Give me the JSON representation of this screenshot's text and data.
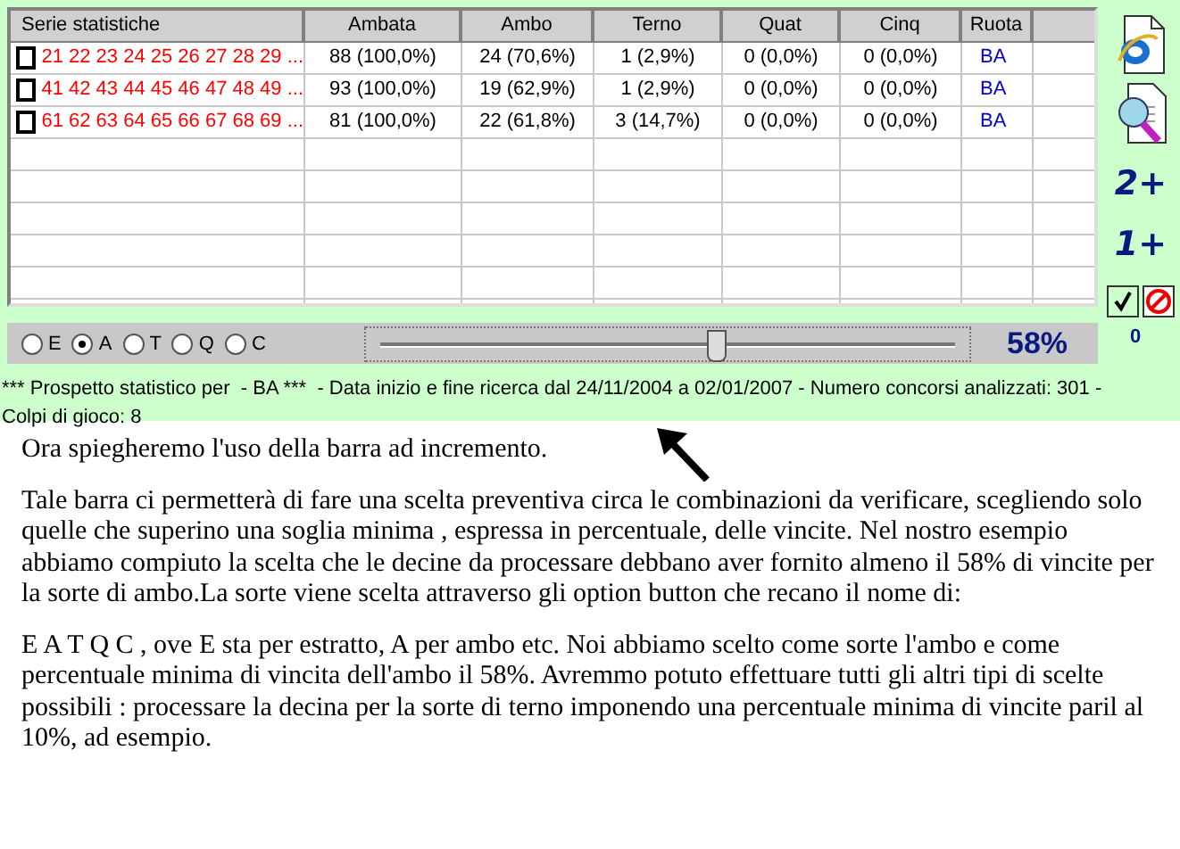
{
  "table": {
    "columns": [
      "Serie statistiche",
      "Ambata",
      "Ambo",
      "Terno",
      "Quat",
      "Cinq",
      "Ruota"
    ],
    "rows": [
      {
        "checked": false,
        "serie": "21 22 23 24 25 26 27 28 29 ...",
        "ambata": "88 (100,0%)",
        "ambo": "24 (70,6%)",
        "terno": "1 (2,9%)",
        "quat": "0 (0,0%)",
        "cinq": "0 (0,0%)",
        "ruota": "BA"
      },
      {
        "checked": false,
        "serie": "41 42 43 44 45 46 47 48 49 ...",
        "ambata": "93 (100,0%)",
        "ambo": "19 (62,9%)",
        "terno": "1 (2,9%)",
        "quat": "0 (0,0%)",
        "cinq": "0 (0,0%)",
        "ruota": "BA"
      },
      {
        "checked": false,
        "serie": "61 62 63 64 65 66 67 68 69 ...",
        "ambata": "81 (100,0%)",
        "ambo": "22 (61,8%)",
        "terno": "3 (14,7%)",
        "quat": "0 (0,0%)",
        "cinq": "0 (0,0%)",
        "ruota": "BA"
      }
    ]
  },
  "side_buttons": [
    {
      "kind": "ie"
    },
    {
      "kind": "preview"
    },
    {
      "kind": "text",
      "label": "2+"
    },
    {
      "kind": "text",
      "label": "1+"
    }
  ],
  "side_counter": "0",
  "options": [
    {
      "label": "E",
      "selected": false
    },
    {
      "label": "A",
      "selected": true
    },
    {
      "label": "T",
      "selected": false
    },
    {
      "label": "Q",
      "selected": false
    },
    {
      "label": "C",
      "selected": false
    }
  ],
  "slider": {
    "level": 0.58,
    "reading": "58%"
  },
  "status": "*** Prospetto statistico per  - BA ***  - Data inizio e fine ricerca dal 24/11/2004 a 02/01/2007 - Numero concorsi analizzati: 301 - Colpi di gioco: 8",
  "heading": "Ora spiegheremo l'uso della barra ad incremento.",
  "paragraphs": [
    "Tale barra ci permetterà di fare una scelta preventiva circa le combinazioni da verificare, scegliendo solo quelle che superino una soglia minima , espressa in percentuale, delle vincite. Nel nostro esempio abbiamo compiuto la scelta che le decine da processare debbano aver fornito almeno il 58% di vincite per la sorte di ambo.La sorte viene scelta attraverso gli option button che recano il nome di:",
    "E  A  T  Q  C , ove E sta per estratto, A per ambo etc. Noi abbiamo scelto come sorte l'ambo e come percentuale minima di vincita dell'ambo il 58%. Avremmo potuto effettuare tutti gli altri tipi di scelte possibili : processare la decina per la sorte di terno imponendo una percentuale minima di vincite paril al 10%, ad esempio."
  ]
}
